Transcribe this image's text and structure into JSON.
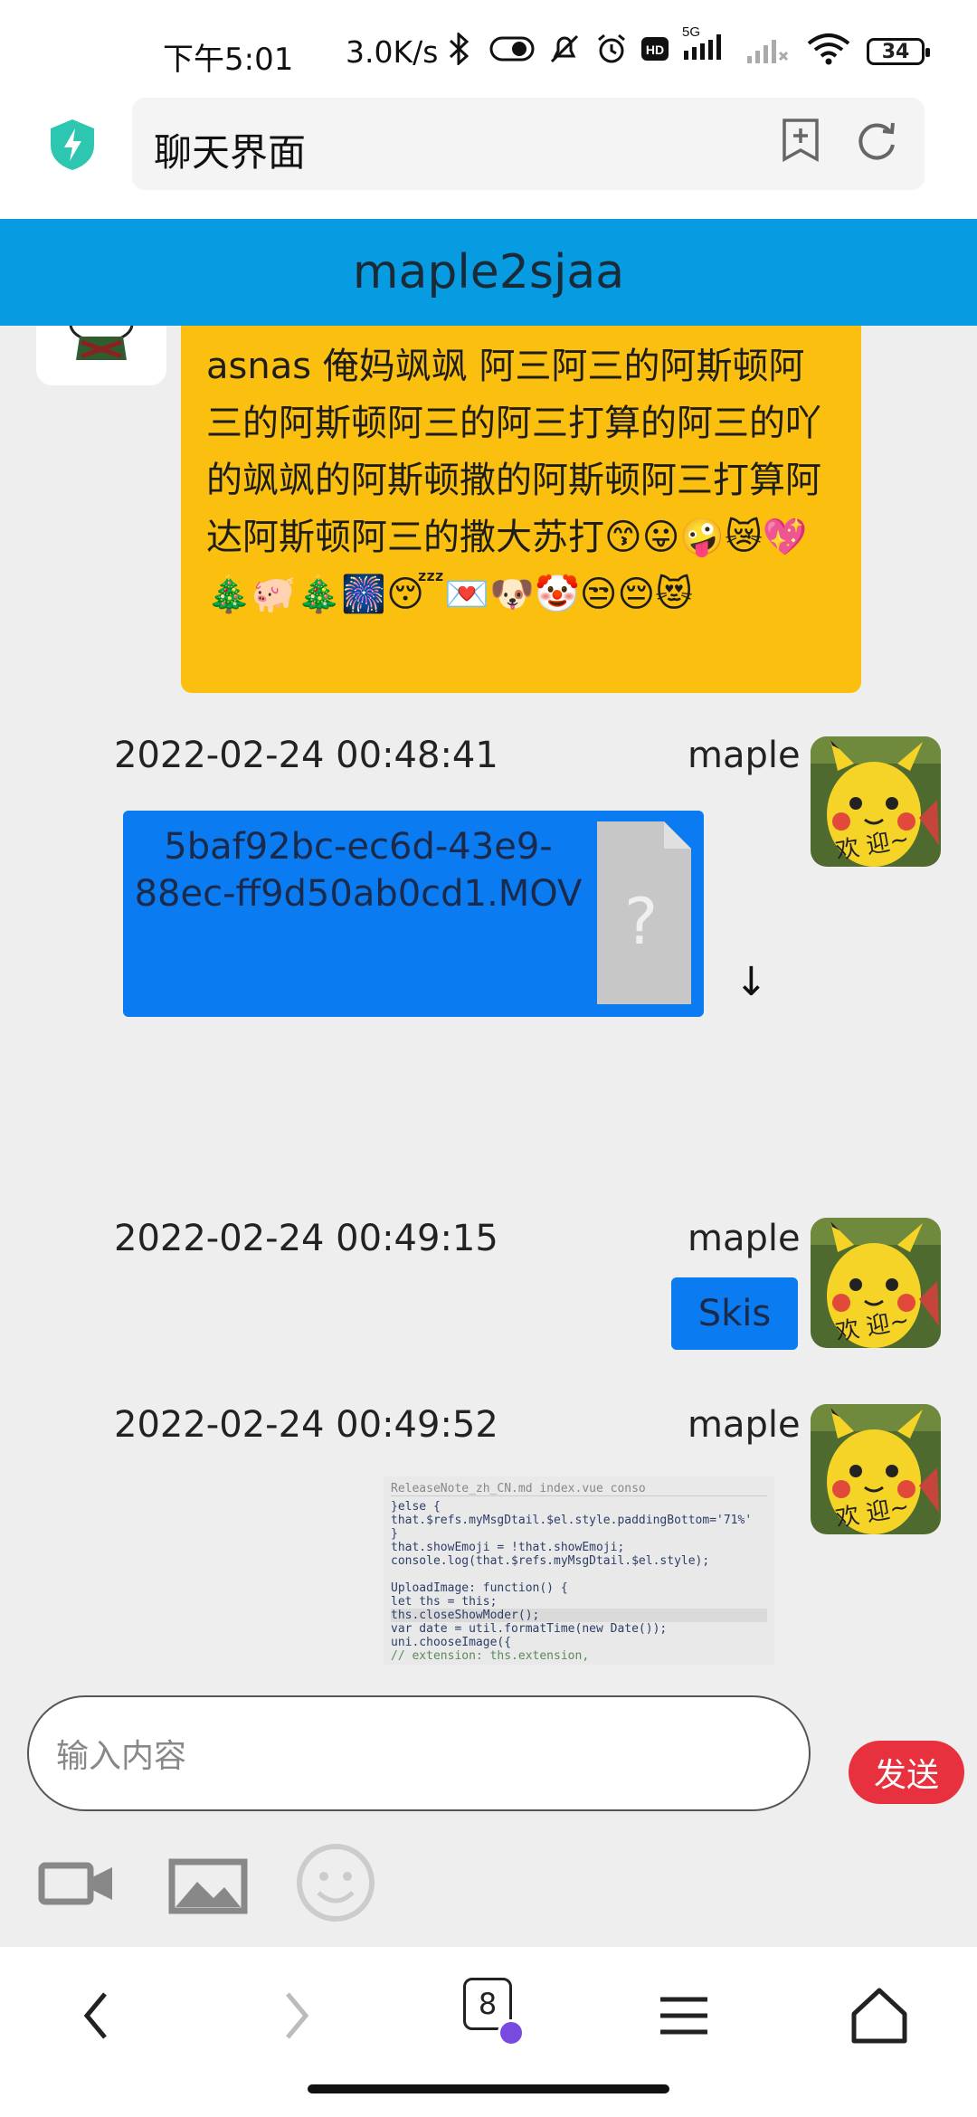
{
  "status_bar": {
    "time": "下午5:01",
    "net_speed": "3.0K/s",
    "network": "5G",
    "battery": "34"
  },
  "browser": {
    "url_title": "聊天界面",
    "tab_count": "8"
  },
  "chat": {
    "title": "maple2sjaa",
    "messages": [
      {
        "type": "text",
        "content": "asnas 俺妈飒飒 阿三阿三的阿斯顿阿三的阿斯顿阿三的阿三打算的阿三的吖的飒飒的阿斯顿撒的阿斯顿阿三打算阿达阿斯顿阿三的撒大苏打😙😛🤪😿💖🎄🐖🎄🎆😴💌🐶🤡😒😔😻"
      },
      {
        "type": "file",
        "timestamp": "2022-02-24 00:48:41",
        "username": "maple",
        "filename": "5baf92bc-ec6d-43e9-88ec-ff9d50ab0cd1.MOV",
        "download_icon": "↓"
      },
      {
        "type": "text",
        "timestamp": "2022-02-24 00:49:15",
        "username": "maple",
        "content": "Skis"
      },
      {
        "type": "image",
        "timestamp": "2022-02-24 00:49:52",
        "username": "maple",
        "image_lines": [
          "ReleaseNote_zh_CN.md          index.vue          conso",
          "}else {",
          "    that.$refs.myMsgDtail.$el.style.paddingBottom='71%'",
          "}",
          "that.showEmoji = !that.showEmoji;",
          "console.log(that.$refs.myMsgDtail.$el.style);",
          "",
          "UploadImage: function() {",
          "  let ths = this;",
          "  ths.closeShowModer();",
          "  var date = util.formatTime(new Date());",
          "  uni.chooseImage({",
          "    // extension: ths.extension,"
        ]
      }
    ]
  },
  "input": {
    "placeholder": "输入内容",
    "send_label": "发送"
  },
  "colors": {
    "title_bar": "#079be1",
    "bubble_blue": "#0a7bf0",
    "bubble_yellow": "#fbbf0f",
    "send_button": "#e8313e"
  }
}
